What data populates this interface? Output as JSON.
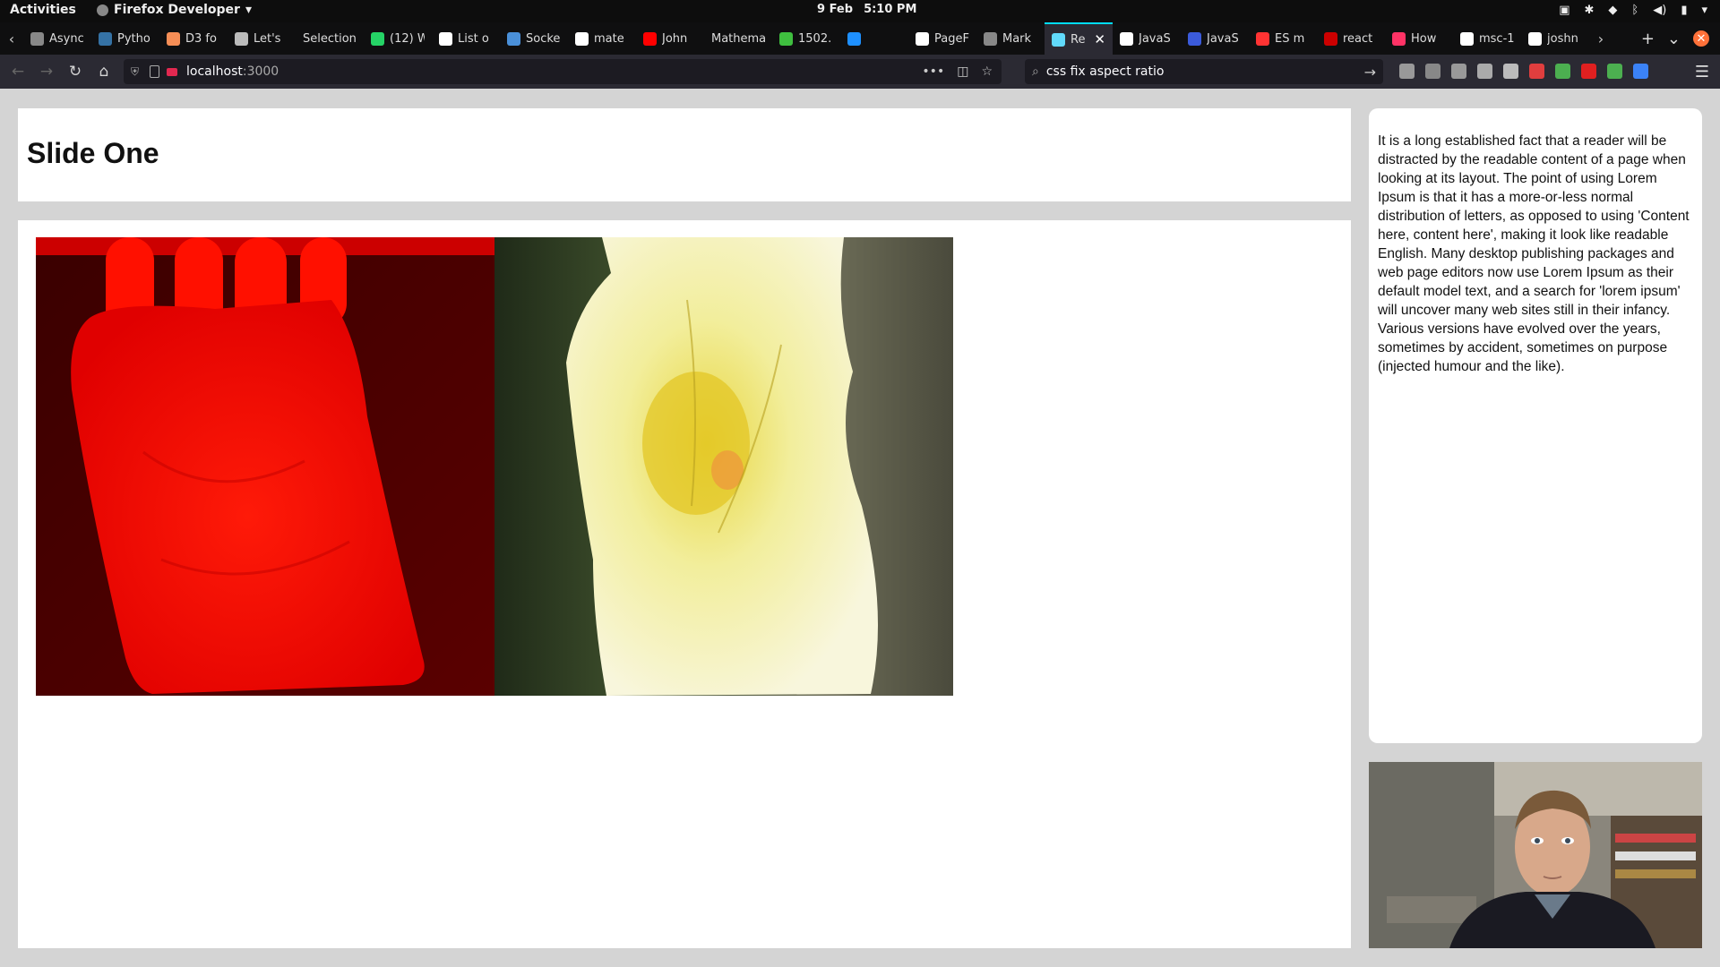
{
  "topbar": {
    "activities": "Activities",
    "app_name": "Firefox Developer",
    "date": "9 Feb",
    "time": "5:10 PM",
    "tray_icons": [
      "screen-share-icon",
      "slack-icon",
      "wifi-icon",
      "bluetooth-icon",
      "volume-icon",
      "battery-icon",
      "chevron-down-icon"
    ]
  },
  "tabs": [
    {
      "label": "Async",
      "icon_color": "#888888"
    },
    {
      "label": "Pytho",
      "icon_color": "#3572a5"
    },
    {
      "label": "D3 fo",
      "icon_color": "#f68e56"
    },
    {
      "label": "Let's",
      "icon_color": "#bbbbbb"
    },
    {
      "label": "Selection",
      "icon_color": ""
    },
    {
      "label": "(12) W",
      "icon_color": "#25d366"
    },
    {
      "label": "List o",
      "icon_color": "#ffffff"
    },
    {
      "label": "Socke",
      "icon_color": "#4a90d9"
    },
    {
      "label": "mate",
      "icon_color": "#ffffff"
    },
    {
      "label": "John",
      "icon_color": "#ff0000"
    },
    {
      "label": "Mathema",
      "icon_color": ""
    },
    {
      "label": "1502.",
      "icon_color": "#3fbf3f"
    },
    {
      "label": "",
      "icon_color": "#1e90ff"
    },
    {
      "label": "PageF",
      "icon_color": "#ffffff"
    },
    {
      "label": "Mark",
      "icon_color": "#888888"
    },
    {
      "label": "Re",
      "icon_color": "#61dafb",
      "active": true
    },
    {
      "label": "JavaS",
      "icon_color": "#ffffff"
    },
    {
      "label": "JavaS",
      "icon_color": "#3b5bdb"
    },
    {
      "label": "ES m",
      "icon_color": "#ff3333"
    },
    {
      "label": "react",
      "icon_color": "#cc0000"
    },
    {
      "label": "How",
      "icon_color": "#ff3366"
    },
    {
      "label": "msc-1",
      "icon_color": "#ffffff"
    },
    {
      "label": "joshn",
      "icon_color": "#ffffff"
    }
  ],
  "navbar": {
    "url_host": "localhost",
    "url_port": ":3000",
    "search_value": "css fix aspect ratio",
    "extension_colors": [
      "#999999",
      "#888888",
      "#999999",
      "#aaaaaa",
      "#bbbbbb",
      "#e03e3e",
      "#4caf50",
      "#e02020",
      "#4caf50",
      "#3b82f6"
    ]
  },
  "slide": {
    "title": "Slide One",
    "notes": "It is a long established fact that a reader will be distracted by the readable content of a page when looking at its layout. The point of using Lorem Ipsum is that it has a more-or-less normal distribution of letters, as opposed to using 'Content here, content here', making it look like readable English. Many desktop publishing packages and web page editors now use Lorem Ipsum as their default model text, and a search for 'lorem ipsum' will uncover many web sites still in their infancy. Various versions have evolved over the years, sometimes by accident, sometimes on purpose (injected humour and the like)."
  },
  "colors": {
    "accent": "#00ddff",
    "page_bg": "#d4d4d4"
  }
}
